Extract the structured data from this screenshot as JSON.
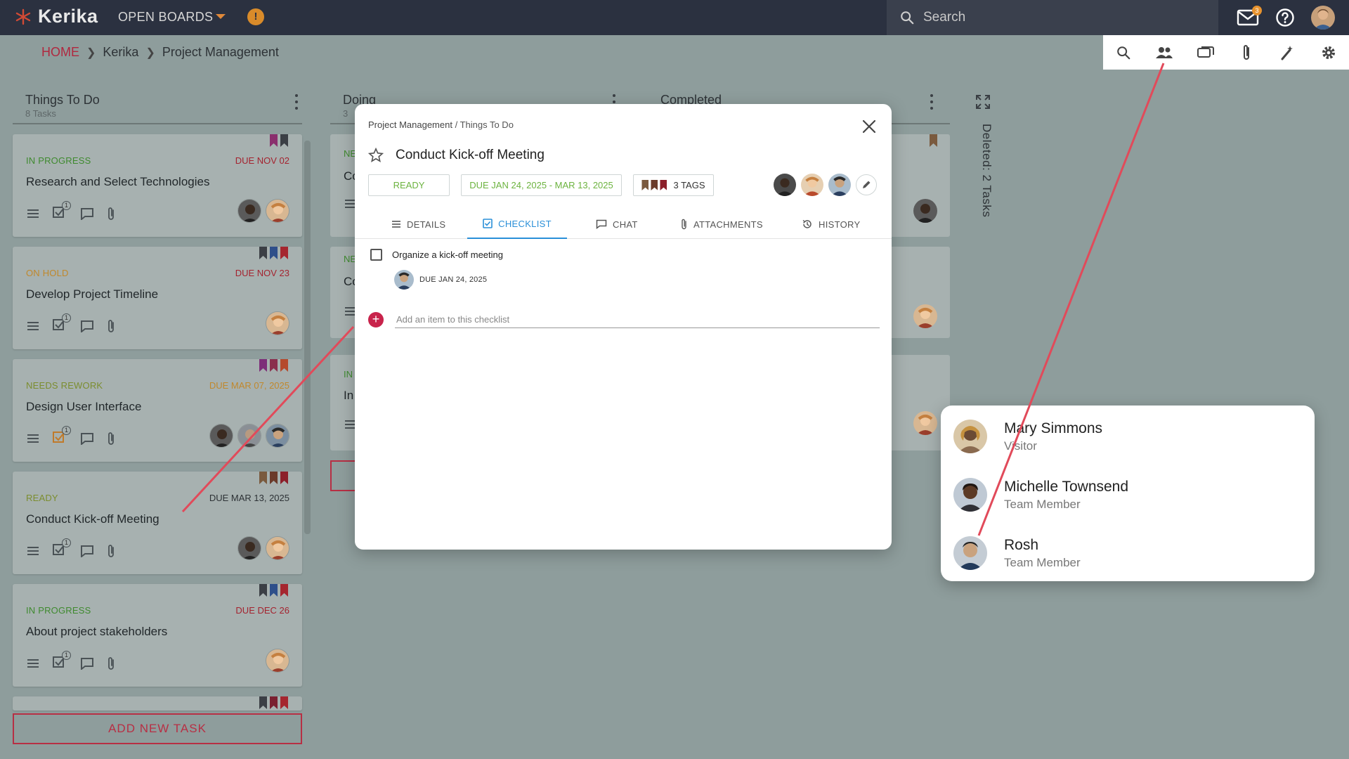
{
  "app": {
    "name": "Kerika",
    "open_boards_label": "OPEN BOARDS",
    "search_placeholder": "Search",
    "mail_count": "3",
    "brand_color": "#b0283f"
  },
  "breadcrumb": {
    "home": "HOME",
    "org": "Kerika",
    "board": "Project Management"
  },
  "columns": [
    {
      "title": "Things To Do",
      "count": "8 Tasks"
    },
    {
      "title": "Doing",
      "count": "3"
    },
    {
      "title": "Completed",
      "count": ""
    }
  ],
  "cards": [
    {
      "status": "IN PROGRESS",
      "due": "DUE NOV 02",
      "title": "Research and Select Technologies",
      "checklist_count": "1"
    },
    {
      "status": "ON HOLD",
      "due": "DUE NOV 23",
      "title": "Develop Project Timeline",
      "checklist_count": "1"
    },
    {
      "status": "NEEDS REWORK",
      "due": "DUE MAR 07, 2025",
      "title": "Design User Interface",
      "checklist_count": "1"
    },
    {
      "status": "READY",
      "due": "DUE MAR 13, 2025",
      "title": "Conduct Kick-off Meeting",
      "checklist_count": "1"
    },
    {
      "status": "IN PROGRESS",
      "due": "DUE DEC 26",
      "title": "About project stakeholders",
      "checklist_count": "1"
    }
  ],
  "add_task_label": "ADD NEW TASK",
  "doing_cards": [
    {
      "status_fragment": "NE",
      "title_fragment": "Co"
    },
    {
      "status_fragment": "NE",
      "title_fragment": "Co"
    },
    {
      "status_fragment": "IN",
      "title_fragment": "In"
    }
  ],
  "deleted_label": "Deleted: 2 Tasks",
  "modal": {
    "crumb_board": "Project Management",
    "crumb_sep": " / ",
    "crumb_column": "Things To Do",
    "title": "Conduct Kick-off Meeting",
    "status": "READY",
    "dates": "DUE JAN 24, 2025 - MAR 13, 2025",
    "tags_label": "3 TAGS",
    "tabs": [
      "DETAILS",
      "CHECKLIST",
      "CHAT",
      "ATTACHMENTS",
      "HISTORY"
    ],
    "checklist": [
      {
        "text": "Organize a kick-off meeting",
        "due": "DUE JAN 24, 2025"
      }
    ],
    "add_item_placeholder": "Add an item to this checklist"
  },
  "members": [
    {
      "name": "Mary Simmons",
      "role": "Visitor"
    },
    {
      "name": "Michelle Townsend",
      "role": "Team Member"
    },
    {
      "name": "Rosh",
      "role": "Team Member"
    }
  ]
}
